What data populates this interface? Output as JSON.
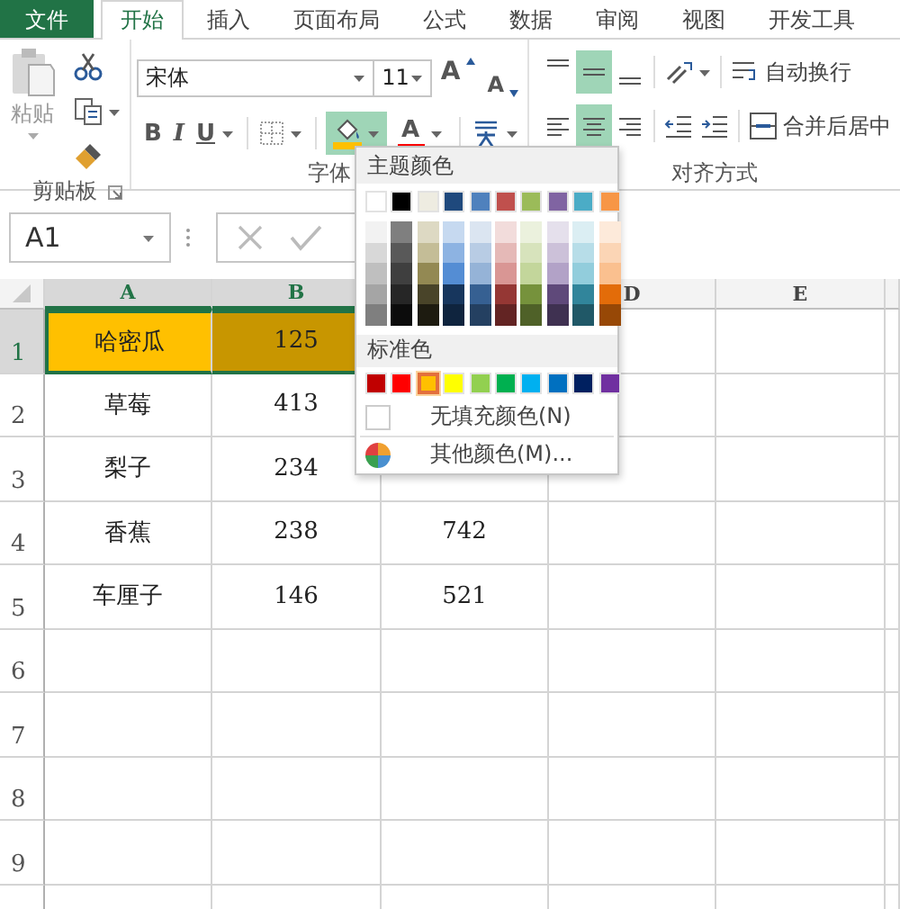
{
  "tabs": [
    {
      "label": "文件",
      "kind": "file",
      "selected": false
    },
    {
      "label": "开始",
      "kind": "tab",
      "selected": true
    },
    {
      "label": "插入",
      "kind": "tab",
      "selected": false
    },
    {
      "label": "页面布局",
      "kind": "tab",
      "selected": false
    },
    {
      "label": "公式",
      "kind": "tab",
      "selected": false
    },
    {
      "label": "数据",
      "kind": "tab",
      "selected": false
    },
    {
      "label": "审阅",
      "kind": "tab",
      "selected": false
    },
    {
      "label": "视图",
      "kind": "tab",
      "selected": false
    },
    {
      "label": "开发工具",
      "kind": "tab",
      "selected": false
    }
  ],
  "ribbon": {
    "clipboard": {
      "label": "剪贴板",
      "paste": "粘贴"
    },
    "font": {
      "label": "字体",
      "font_name": "宋体",
      "font_size": "11",
      "grow": "A",
      "shrink": "A",
      "bold": "B",
      "italic": "I",
      "underline": "U",
      "fill_color": {
        "color": "#ffc000",
        "expanded": true
      },
      "font_color": {
        "glyph": "A",
        "color": "#ff0000"
      }
    },
    "alignment": {
      "label": "对齐方式",
      "vertical": [
        {
          "kind": "top",
          "selected": false
        },
        {
          "kind": "middle",
          "selected": true
        },
        {
          "kind": "bottom",
          "selected": false
        }
      ],
      "horizontal": [
        {
          "kind": "left",
          "selected": false
        },
        {
          "kind": "center",
          "selected": true
        },
        {
          "kind": "right",
          "selected": false
        }
      ],
      "wrap_text": "自动换行",
      "merge_center": "合并后居中"
    }
  },
  "formula_bar": {
    "name_box": "A1"
  },
  "sheet": {
    "columns": [
      {
        "label": "A",
        "selected": true
      },
      {
        "label": "B",
        "selected": true
      },
      {},
      {
        "label": "D",
        "selected": false
      },
      {
        "label": "E",
        "selected": false
      }
    ],
    "rows": [
      {
        "number": "1",
        "selected": true,
        "cells": [
          {
            "text": "哈密瓜",
            "color": "#ffc000"
          },
          {
            "text": "125",
            "color": "#c89600"
          }
        ]
      },
      {
        "number": "2",
        "selected": false,
        "cells": [
          {
            "text": "草莓"
          },
          {
            "text": "413"
          }
        ]
      },
      {
        "number": "3",
        "selected": false,
        "cells": [
          {
            "text": "梨子"
          },
          {
            "text": "234"
          }
        ]
      },
      {
        "number": "4",
        "selected": false,
        "cells": [
          {
            "text": "香蕉"
          },
          {
            "text": "238"
          },
          {
            "text": "742"
          }
        ]
      },
      {
        "number": "5",
        "selected": false,
        "cells": [
          {
            "text": "车厘子"
          },
          {
            "text": "146"
          },
          {
            "text": "521"
          }
        ]
      },
      {
        "number": "6",
        "selected": false
      },
      {
        "number": "7",
        "selected": false
      },
      {
        "number": "8",
        "selected": false
      },
      {
        "number": "9",
        "selected": false
      },
      {
        "selected": false
      }
    ]
  },
  "color_menu": {
    "theme_title": "主题颜色",
    "theme_colors": [
      {
        "color": "#ffffff",
        "selected": false,
        "shades": [
          {
            "color": "#f2f2f2",
            "selected": false
          },
          {
            "color": "#d8d8d8",
            "selected": false
          },
          {
            "color": "#bfbfbf",
            "selected": false
          },
          {
            "color": "#a5a5a5",
            "selected": false
          },
          {
            "color": "#7f7f7f",
            "selected": false
          }
        ]
      },
      {
        "color": "#000000",
        "selected": false,
        "shades": [
          {
            "color": "#7f7f7f",
            "selected": false
          },
          {
            "color": "#595959",
            "selected": false
          },
          {
            "color": "#3f3f3f",
            "selected": false
          },
          {
            "color": "#262626",
            "selected": false
          },
          {
            "color": "#0c0c0c",
            "selected": false
          }
        ]
      },
      {
        "color": "#eeece1",
        "selected": false,
        "shades": [
          {
            "color": "#ddd9c3",
            "selected": false
          },
          {
            "color": "#c4bd97",
            "selected": false
          },
          {
            "color": "#938953",
            "selected": false
          },
          {
            "color": "#494429",
            "selected": false
          },
          {
            "color": "#1d1b10",
            "selected": false
          }
        ]
      },
      {
        "color": "#1f497d",
        "selected": false,
        "shades": [
          {
            "color": "#c6d9f0",
            "selected": false
          },
          {
            "color": "#8db3e2",
            "selected": false
          },
          {
            "color": "#548dd4",
            "selected": false
          },
          {
            "color": "#17365d",
            "selected": false
          },
          {
            "color": "#0f243e",
            "selected": false
          }
        ]
      },
      {
        "color": "#4f81bd",
        "selected": false,
        "shades": [
          {
            "color": "#dbe5f1",
            "selected": false
          },
          {
            "color": "#b8cce4",
            "selected": false
          },
          {
            "color": "#95b3d7",
            "selected": false
          },
          {
            "color": "#366092",
            "selected": false
          },
          {
            "color": "#244061",
            "selected": false
          }
        ]
      },
      {
        "color": "#c0504d",
        "selected": false,
        "shades": [
          {
            "color": "#f2dcdb",
            "selected": false
          },
          {
            "color": "#e5b9b7",
            "selected": false
          },
          {
            "color": "#d99694",
            "selected": false
          },
          {
            "color": "#953734",
            "selected": false
          },
          {
            "color": "#632423",
            "selected": false
          }
        ]
      },
      {
        "color": "#9bbb59",
        "selected": false,
        "shades": [
          {
            "color": "#ebf1dd",
            "selected": false
          },
          {
            "color": "#d7e3bc",
            "selected": false
          },
          {
            "color": "#c3d69b",
            "selected": false
          },
          {
            "color": "#76923c",
            "selected": false
          },
          {
            "color": "#4f6128",
            "selected": false
          }
        ]
      },
      {
        "color": "#8064a2",
        "selected": false,
        "shades": [
          {
            "color": "#e5e0ec",
            "selected": false
          },
          {
            "color": "#ccc1d9",
            "selected": false
          },
          {
            "color": "#b2a2c7",
            "selected": false
          },
          {
            "color": "#5f497a",
            "selected": false
          },
          {
            "color": "#3f3151",
            "selected": false
          }
        ]
      },
      {
        "color": "#4bacc6",
        "selected": false,
        "shades": [
          {
            "color": "#dbeef3",
            "selected": false
          },
          {
            "color": "#b7dde8",
            "selected": false
          },
          {
            "color": "#92cddc",
            "selected": false
          },
          {
            "color": "#31859b",
            "selected": false
          },
          {
            "color": "#205867",
            "selected": false
          }
        ]
      },
      {
        "color": "#f79646",
        "selected": false,
        "shades": [
          {
            "color": "#fdeada",
            "selected": false
          },
          {
            "color": "#fbd5b5",
            "selected": false
          },
          {
            "color": "#fac08f",
            "selected": false
          },
          {
            "color": "#e36c09",
            "selected": false
          },
          {
            "color": "#974806",
            "selected": false
          }
        ]
      }
    ],
    "standard_title": "标准色",
    "standard_colors": [
      {
        "color": "#c00000",
        "selected": false
      },
      {
        "color": "#ff0000",
        "selected": false
      },
      {
        "color": "#ffc000",
        "selected": true
      },
      {
        "color": "#ffff00",
        "selected": false
      },
      {
        "color": "#92d050",
        "selected": false
      },
      {
        "color": "#00b050",
        "selected": false
      },
      {
        "color": "#00b0f0",
        "selected": false
      },
      {
        "color": "#0070c0",
        "selected": false
      },
      {
        "color": "#002060",
        "selected": false
      },
      {
        "color": "#7030a0",
        "selected": false
      }
    ],
    "no_fill": "无填充颜色(N)",
    "more_colors": "其他颜色(M)..."
  }
}
